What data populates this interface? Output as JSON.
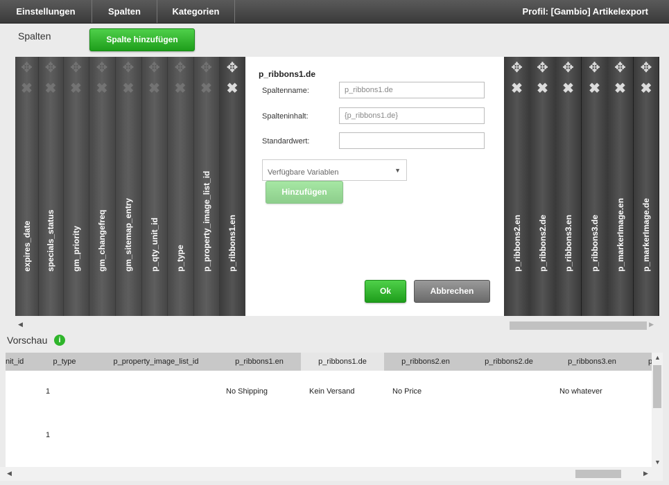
{
  "nav": {
    "tabs": [
      "Einstellungen",
      "Spalten",
      "Kategorien"
    ],
    "profile": "Profil: [Gambio] Artikelexport"
  },
  "columns_section": {
    "title": "Spalten",
    "add_button": "Spalte hinzufügen",
    "left_columns": [
      "expires_date",
      "specials_status",
      "gm_priority",
      "gm_changefreq",
      "gm_sitemap_entry",
      "p_qty_unit_id",
      "p_type",
      "p_property_image_list_id",
      "p_ribbons1.en"
    ],
    "right_columns": [
      "p_ribbons2.en",
      "p_ribbons2.de",
      "p_ribbons3.en",
      "p_ribbons3.de",
      "p_markerImage.en",
      "p_markerImage.de"
    ]
  },
  "editor": {
    "title": "p_ribbons1.de",
    "name_label": "Spaltenname:",
    "name_value": "p_ribbons1.de",
    "content_label": "Spalteninhalt:",
    "content_value": "{p_ribbons1.de}",
    "default_label": "Standardwert:",
    "default_value": "",
    "variables_placeholder": "Verfügbare Variablen",
    "add_button": "Hinzufügen",
    "ok_button": "Ok",
    "cancel_button": "Abbrechen"
  },
  "preview": {
    "title": "Vorschau",
    "info_icon": "i",
    "headers": [
      "nit_id",
      "p_type",
      "p_property_image_list_id",
      "p_ribbons1.en",
      "p_ribbons1.de",
      "p_ribbons2.en",
      "p_ribbons2.de",
      "p_ribbons3.en",
      "p"
    ],
    "rows": [
      [
        "",
        "1",
        "",
        "No Shipping",
        "Kein Versand",
        "No Price",
        "",
        "No whatever"
      ],
      [
        "",
        "1",
        "",
        "",
        "",
        "",
        "",
        ""
      ]
    ]
  },
  "icons": {
    "move": "move-arrows-icon",
    "delete": "close-x-icon",
    "left_arrow": "scroll-left-arrow-icon",
    "right_arrow": "scroll-right-arrow-icon",
    "up_arrow": "scroll-up-arrow-icon",
    "down_arrow": "scroll-down-arrow-icon",
    "caret": "dropdown-caret-icon"
  },
  "colors": {
    "green": "#2fb52b",
    "column_dark": "#444444",
    "header_gray": "#c8c8c8"
  }
}
